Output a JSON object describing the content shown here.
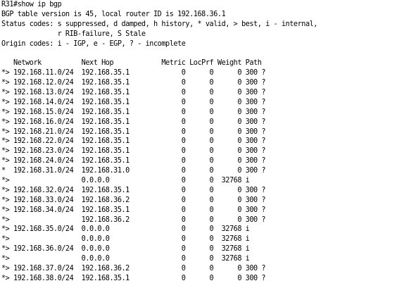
{
  "terminal": {
    "prompt_command": "R31#show ip bgp",
    "header": [
      "BGP table version is 45, local router ID is 192.168.36.1",
      "Status codes: s suppressed, d damped, h history, * valid, > best, i - internal,",
      "              r RIB-failure, S Stale",
      "Origin codes: i - IGP, e - EGP, ? - incomplete"
    ],
    "blank": "",
    "column_header": "   Network          Next Hop            Metric LocPrf Weight Path",
    "rows": [
      "*> 192.168.11.0/24  192.168.35.1             0      0      0 300 ?",
      "*> 192.168.12.0/24  192.168.35.1             0      0      0 300 ?",
      "*> 192.168.13.0/24  192.168.35.1             0      0      0 300 ?",
      "*> 192.168.14.0/24  192.168.35.1             0      0      0 300 ?",
      "*> 192.168.15.0/24  192.168.35.1             0      0      0 300 ?",
      "*> 192.168.16.0/24  192.168.35.1             0      0      0 300 ?",
      "*> 192.168.21.0/24  192.168.35.1             0      0      0 300 ?",
      "*> 192.168.22.0/24  192.168.35.1             0      0      0 300 ?",
      "*> 192.168.23.0/24  192.168.35.1             0      0      0 300 ?",
      "*> 192.168.24.0/24  192.168.35.1             0      0      0 300 ?",
      "*  192.168.31.0/24  192.168.31.0             0      0      0 300 ?",
      "*>                  0.0.0.0                  0      0  32768 i",
      "*> 192.168.32.0/24  192.168.35.1             0      0      0 300 ?",
      "*> 192.168.33.0/24  192.168.36.2             0      0      0 300 ?",
      "*> 192.168.34.0/24  192.168.35.1             0      0      0 300 ?",
      "*>                  192.168.36.2             0      0      0 300 ?",
      "*> 192.168.35.0/24  0.0.0.0                  0      0  32768 i",
      "*>                  0.0.0.0                  0      0  32768 i",
      "*> 192.168.36.0/24  0.0.0.0                  0      0  32768 i",
      "*>                  0.0.0.0                  0      0  32768 i",
      "*> 192.168.37.0/24  192.168.36.2             0      0      0 300 ?",
      "*> 192.168.38.0/24  192.168.35.1             0      0      0 300 ?"
    ]
  }
}
